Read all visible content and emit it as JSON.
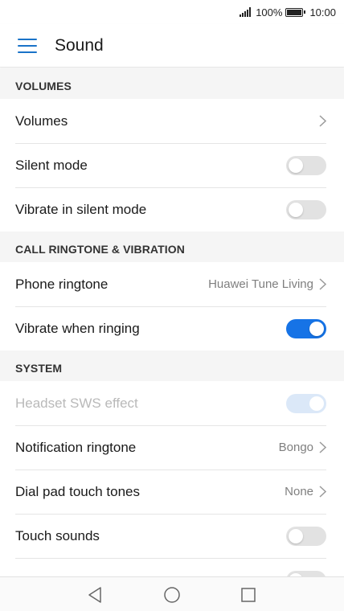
{
  "status_bar": {
    "battery_percent": "100%",
    "time": "10:00",
    "signal_icon": "signal-icon",
    "battery_icon": "battery-icon"
  },
  "app_bar": {
    "title": "Sound",
    "menu_icon": "menu-icon"
  },
  "sections": [
    {
      "header": "VOLUMES",
      "items": [
        {
          "label": "Volumes",
          "control": "chevron"
        },
        {
          "label": "Silent mode",
          "control": "toggle",
          "state": "off"
        },
        {
          "label": "Vibrate in silent mode",
          "control": "toggle",
          "state": "off"
        }
      ]
    },
    {
      "header": "CALL RINGTONE & VIBRATION",
      "items": [
        {
          "label": "Phone ringtone",
          "value": "Huawei Tune Living",
          "control": "chevron"
        },
        {
          "label": "Vibrate when ringing",
          "control": "toggle",
          "state": "on"
        }
      ]
    },
    {
      "header": "SYSTEM",
      "items": [
        {
          "label": "Headset SWS effect",
          "control": "toggle",
          "state": "on",
          "disabled": true
        },
        {
          "label": "Notification ringtone",
          "value": "Bongo",
          "control": "chevron"
        },
        {
          "label": "Dial pad touch tones",
          "value": "None",
          "control": "chevron"
        },
        {
          "label": "Touch sounds",
          "control": "toggle",
          "state": "off"
        },
        {
          "label": "",
          "control": "toggle",
          "state": "off"
        }
      ]
    }
  ],
  "nav_bar": {
    "back_icon": "back-icon",
    "home_icon": "home-icon",
    "recents_icon": "recents-icon"
  },
  "colors": {
    "accent": "#1673e6",
    "menu_icon": "#1a73c8",
    "section_background": "#f5f5f5",
    "toggle_off": "#e2e2e2",
    "disabled_text": "#b9b9b9"
  }
}
